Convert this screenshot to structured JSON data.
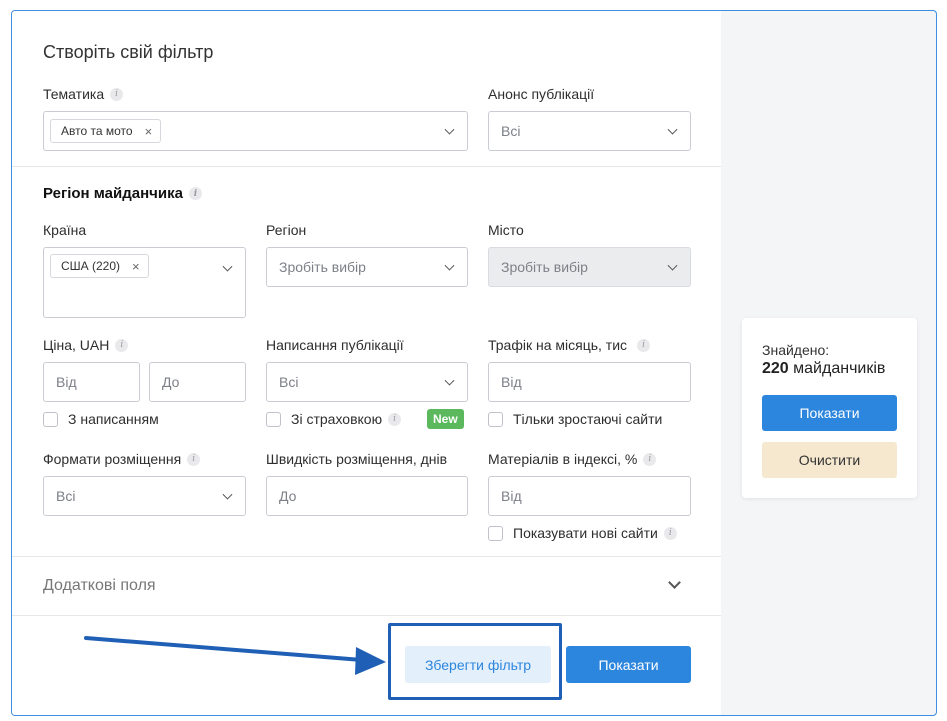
{
  "header": {
    "title": "Створіть свій фільтр"
  },
  "topic": {
    "label": "Тематика",
    "chip": "Авто та мото",
    "chip_close": "×"
  },
  "announce": {
    "label": "Анонс публікації",
    "value": "Всі"
  },
  "region_section": {
    "title": "Регіон майданчика"
  },
  "country": {
    "label": "Країна",
    "chip": "США (220)",
    "chip_close": "×"
  },
  "region": {
    "label": "Регіон",
    "placeholder": "Зробіть вибір"
  },
  "city": {
    "label": "Місто",
    "placeholder": "Зробіть вибір"
  },
  "price": {
    "label": "Ціна, UAH",
    "from": "Від",
    "to": "До",
    "checkbox": "З написанням"
  },
  "writing": {
    "label": "Написання публікації",
    "value": "Всі",
    "checkbox": "Зі страховкою",
    "badge": "New"
  },
  "traffic": {
    "label": "Трафік на місяць, тис",
    "from": "Від",
    "checkbox": "Тільки зростаючі сайти"
  },
  "formats": {
    "label": "Формати розміщення",
    "value": "Всі"
  },
  "speed": {
    "label": "Швидкість розміщення, днів",
    "placeholder": "До"
  },
  "indexed": {
    "label": "Матеріалів в індексі, %",
    "from": "Від",
    "checkbox": "Показувати нові сайти"
  },
  "extra": {
    "label": "Додаткові поля"
  },
  "footer": {
    "save_label": "Зберегти фільтр",
    "show_label": "Показати"
  },
  "side": {
    "found_label": "Знайдено:",
    "count": "220",
    "count_suffix": "майданчиків",
    "show_label": "Показати",
    "clear_label": "Очистити"
  },
  "info_glyph": "i",
  "colors": {
    "primary": "#2d86dd",
    "accent_highlight": "#1f5fb5",
    "badge_green": "#5cb85c",
    "clear_bg": "#f5e8cf"
  }
}
